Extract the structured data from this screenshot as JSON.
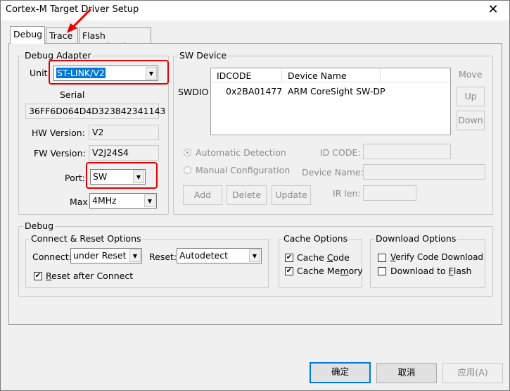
{
  "window": {
    "title": "Cortex-M Target Driver Setup",
    "close_glyph": "✕"
  },
  "tabs": [
    {
      "label": "Debug"
    },
    {
      "label": "Trace"
    },
    {
      "label": "Flash Download"
    }
  ],
  "debug_adapter": {
    "title": "Debug Adapter",
    "unit_label": "Unit:",
    "unit_value": "ST-LINK/V2",
    "serial_label": "Serial",
    "serial_value": "36FF6D064D4D323842341143",
    "hw_label": "HW Version:",
    "hw_value": "V2",
    "fw_label": "FW Version:",
    "fw_value": "V2J24S4",
    "port_label": "Port:",
    "port_value": "SW",
    "max_label": "Max",
    "max_value": "4MHz"
  },
  "sw_device": {
    "title": "SW Device",
    "swdio_label": "SWDIO",
    "columns": [
      "IDCODE",
      "Device Name"
    ],
    "rows": [
      {
        "idcode": "0x2BA01477",
        "device_name": "ARM CoreSight SW-DP"
      }
    ],
    "move_label": "Move",
    "up_label": "Up",
    "down_label": "Down",
    "auto_detect_label": "Automatic Detection",
    "manual_config_label": "Manual Configuration",
    "id_code_label": "ID CODE:",
    "device_name_label": "Device Name:",
    "ir_len_label": "IR len:",
    "add_label": "Add",
    "delete_label": "Delete",
    "update_label": "Update"
  },
  "debug": {
    "title": "Debug",
    "connect_reset": {
      "title": "Connect & Reset Options",
      "connect_label": "Connect:",
      "connect_value": "under Reset",
      "reset_label": "Reset:",
      "reset_value": "Autodetect",
      "reset_after_connect_label": "Reset after Connect",
      "reset_after_connect_checked": true
    },
    "cache": {
      "title": "Cache Options",
      "cache_code_label": "Cache Code",
      "cache_code_checked": true,
      "cache_memory_label": "Cache Memory",
      "cache_memory_checked": true
    },
    "download": {
      "title": "Download Options",
      "verify_label": "Verify Code Download",
      "verify_checked": false,
      "flash_label": "Download to Flash",
      "flash_checked": false
    }
  },
  "buttons": {
    "ok": "确定",
    "cancel": "取消",
    "apply": "应用(A)"
  },
  "check_glyph": "✔",
  "dropdown_glyph": "▼",
  "colors": {
    "annotation_red": "#e60000",
    "selection_blue": "#0078d7"
  }
}
